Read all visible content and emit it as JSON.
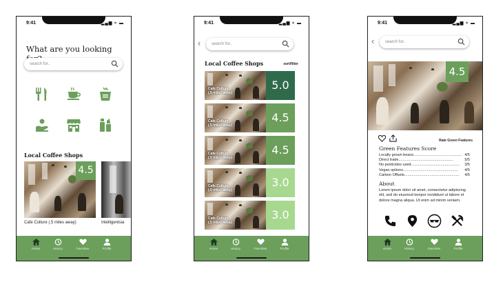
{
  "colors": {
    "accent": "#6b9f5b",
    "dark_green": "#2f6b4b",
    "light_green": "#a7d88f"
  },
  "status": {
    "time": "9:41",
    "signal": "▂▄▆ ≈ ▬"
  },
  "search_placeholder": "search for..",
  "nav": [
    {
      "label": "Home",
      "icon": "home-icon"
    },
    {
      "label": "History",
      "icon": "history-icon"
    },
    {
      "label": "Favorites",
      "icon": "heart-icon"
    },
    {
      "label": "Profile",
      "icon": "profile-icon"
    }
  ],
  "screen1": {
    "heading": "What are you looking for?",
    "categories": [
      {
        "icon": "restaurant-icon"
      },
      {
        "icon": "coffee-icon"
      },
      {
        "icon": "grocery-icon"
      },
      {
        "icon": "donation-icon"
      },
      {
        "icon": "store-icon"
      },
      {
        "icon": "cosmetics-icon"
      }
    ],
    "section_title": "Local Coffee Shops",
    "cards": [
      {
        "name": "Cafe Culture (.5 miles away)",
        "score": "4.5"
      },
      {
        "name": "Intelligentsia"
      }
    ]
  },
  "screen2": {
    "section_title": "Local Coffee Shops",
    "sort_label": "sort/filter",
    "shops": [
      {
        "line1": "Cafe Culture",
        "line2": "(.5 miles away)",
        "score": "5.0",
        "color": "#2f6b4b"
      },
      {
        "line1": "Cafe Culture",
        "line2": "(.5 miles away)",
        "score": "4.5",
        "color": "#6b9f5b"
      },
      {
        "line1": "Cafe Culture",
        "line2": "(.5 miles away)",
        "score": "4.5",
        "color": "#6b9f5b"
      },
      {
        "line1": "Cafe Culture",
        "line2": "(.5 miles away)",
        "score": "3.0",
        "color": "#a7d88f"
      },
      {
        "line1": "Cafe Culture",
        "line2": "(.5 miles away)",
        "score": "3.0",
        "color": "#a7d88f"
      }
    ]
  },
  "screen3": {
    "score": "4.5",
    "rate_label": "Rate Green Features",
    "features_title": "Green Features Score",
    "features": [
      {
        "label": "Locally grown beans",
        "dots": "..............................................",
        "value": "4/5"
      },
      {
        "label": "Direct trade",
        "dots": "..................................................................",
        "value": "5/5"
      },
      {
        "label": "No pesticides used",
        "dots": "..............................................",
        "value": "3/5"
      },
      {
        "label": "Vegan options",
        "dots": ".........................................................",
        "value": "4/5"
      },
      {
        "label": "Carbon Offsets",
        "dots": ".......................................................",
        "value": "4/5"
      }
    ],
    "about_title": "About",
    "about_text": "Lorem ipsum dolor sit amet, consectetur adipiscing elit, sed do eiusmod tempor incididunt ut labore et dolore magna aliqua. Ut enim ad minim veniam.",
    "actions": [
      {
        "icon": "phone-icon"
      },
      {
        "icon": "location-pin-icon"
      },
      {
        "icon": "glasses-icon"
      },
      {
        "icon": "utensils-icon"
      }
    ]
  }
}
